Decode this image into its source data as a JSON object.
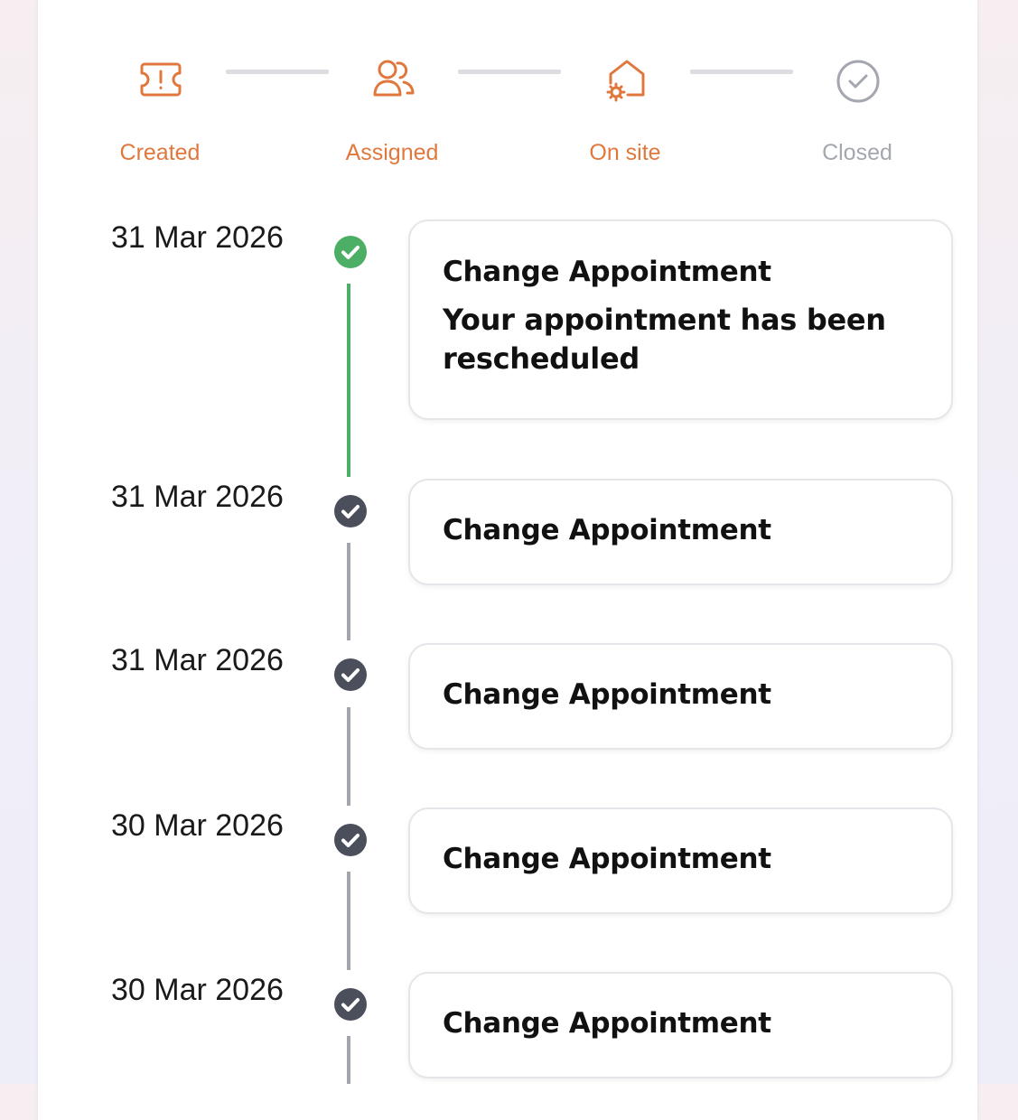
{
  "colors": {
    "accent": "#e0783e",
    "inactive": "#a4a7b0",
    "success": "#4caf65",
    "done_dot": "#4b4f5c",
    "line_gray": "#a3a5ad"
  },
  "stepper": {
    "steps": [
      {
        "label": "Created",
        "icon": "ticket-icon",
        "state": "completed"
      },
      {
        "label": "Assigned",
        "icon": "users-icon",
        "state": "completed"
      },
      {
        "label": "On site",
        "icon": "home-gear-icon",
        "state": "completed"
      },
      {
        "label": "Closed",
        "icon": "check-circle-icon",
        "state": "pending"
      }
    ]
  },
  "timeline": {
    "entries": [
      {
        "date": "31 Mar 2026",
        "title": "Change Appointment",
        "description": "Your appointment has been rescheduled",
        "status": "latest"
      },
      {
        "date": "31 Mar 2026",
        "title": "Change Appointment",
        "description": "",
        "status": "done"
      },
      {
        "date": "31 Mar 2026",
        "title": "Change Appointment",
        "description": "",
        "status": "done"
      },
      {
        "date": "30 Mar 2026",
        "title": "Change Appointment",
        "description": "",
        "status": "done"
      },
      {
        "date": "30 Mar 2026",
        "title": "Change Appointment",
        "description": "",
        "status": "done"
      }
    ]
  }
}
